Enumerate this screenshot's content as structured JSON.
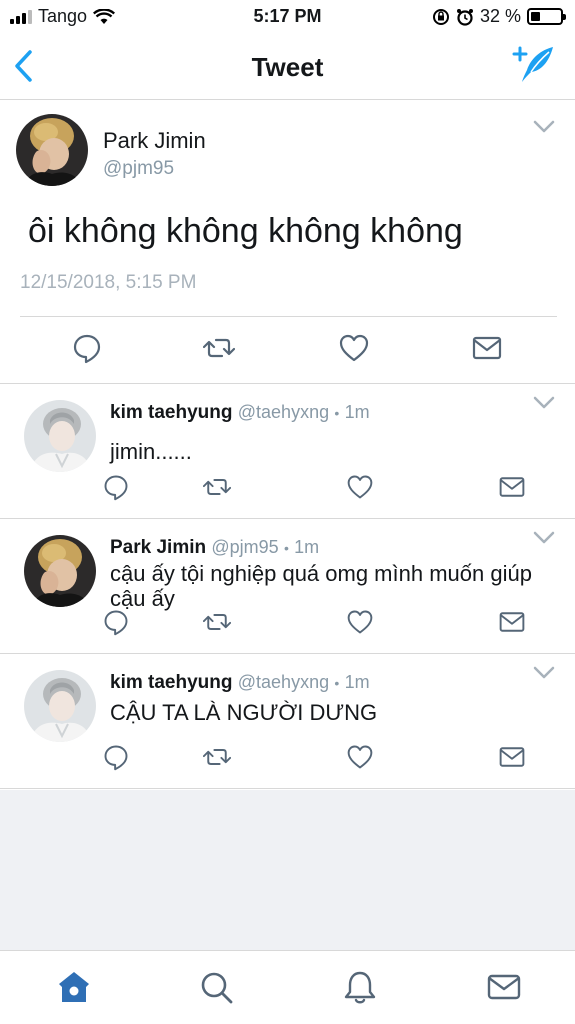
{
  "status_bar": {
    "carrier": "Tango",
    "time": "5:17 PM",
    "battery": "32 %",
    "battery_level": 0.32
  },
  "nav": {
    "title": "Tweet",
    "back_icon": "chevron-left-icon",
    "compose_icon": "compose-tweet-icon"
  },
  "colors": {
    "accent": "#1da1f2",
    "nav_blue": "#2f6fb5",
    "secondary_text": "#8899a6",
    "divider": "#d8d8d8"
  },
  "main_tweet": {
    "name": "Park Jimin",
    "handle": "@pjm95",
    "text": "ôi không không không không",
    "timestamp": "12/15/2018, 5:15 PM"
  },
  "replies": [
    {
      "name": "kim taehyung",
      "handle": "@taehyxng",
      "dot": "•",
      "age": "1m",
      "text": "jimin......"
    },
    {
      "name": "Park Jimin",
      "handle": "@pjm95",
      "dot": "•",
      "age": "1m",
      "text": "cậu ấy tội nghiệp quá omg mình muốn giúp cậu ấy"
    },
    {
      "name": "kim taehyung",
      "handle": "@taehyxng",
      "dot": "•",
      "age": "1m",
      "text": "CẬU TA LÀ NGƯỜI DƯNG"
    }
  ],
  "tabs": [
    "home-icon",
    "search-icon",
    "notifications-bell-icon",
    "messages-envelope-icon"
  ]
}
